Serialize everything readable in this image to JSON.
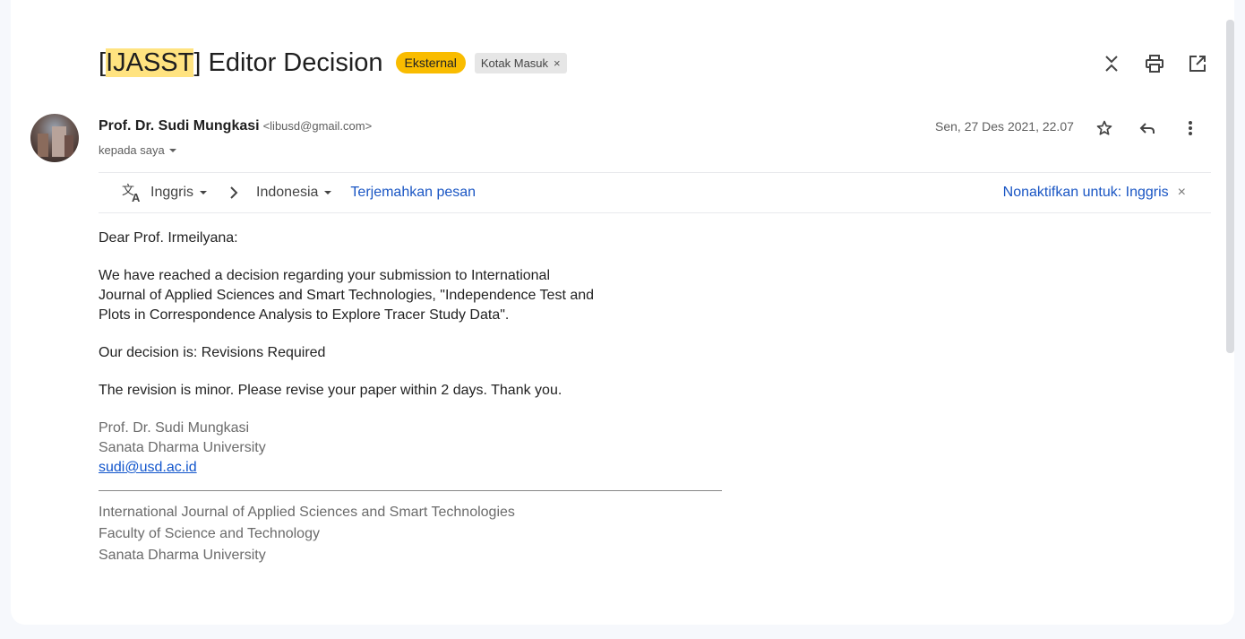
{
  "subject": {
    "prefix_bracket_open": "[",
    "highlight": "IJASST",
    "rest": "] Editor Decision",
    "label_external": "Eksternal",
    "label_inbox": "Kotak Masuk",
    "label_remove": "×"
  },
  "sender": {
    "name": "Prof. Dr. Sudi Mungkasi",
    "email": "<libusd@gmail.com>",
    "to": "kepada saya",
    "date": "Sen, 27 Des 2021, 22.07"
  },
  "translate": {
    "from_lang": "Inggris",
    "to_lang": "Indonesia",
    "translate_link": "Terjemahkan pesan",
    "disable": "Nonaktifkan untuk: Inggris",
    "close": "×"
  },
  "body": {
    "greeting": "Dear Prof. Irmeilyana:",
    "para1_l1": "We have reached a decision regarding your submission to International",
    "para1_l2": "Journal of Applied Sciences and Smart Technologies, \"Independence Test and",
    "para1_l3": "Plots in Correspondence Analysis to Explore Tracer Study Data\".",
    "decision": "Our decision is: Revisions Required",
    "note": "The revision is minor. Please revise your paper within 2 days. Thank you.",
    "sig_name": "Prof. Dr. Sudi Mungkasi",
    "sig_univ": "Sanata Dharma University",
    "sig_email": "sudi@usd.ac.id",
    "footer_journal": "International Journal of Applied Sciences and Smart Technologies",
    "footer_faculty": "Faculty of Science and Technology",
    "footer_univ": "Sanata Dharma University"
  },
  "colors": {
    "external_chip": "#f9bc00",
    "highlight": "#ffe380",
    "link": "#1a56c4"
  }
}
